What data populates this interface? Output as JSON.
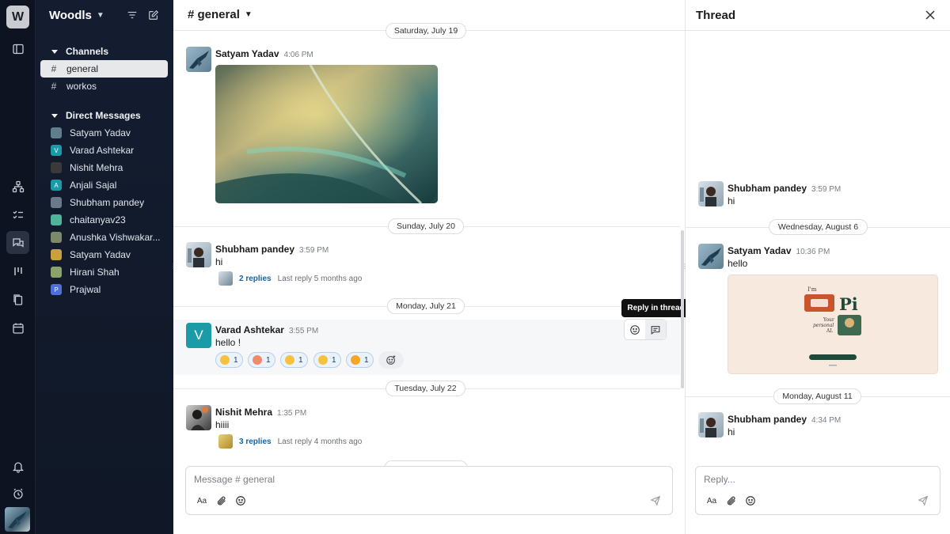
{
  "workspace": {
    "logo_letter": "W",
    "name": "Woodls"
  },
  "sidebar": {
    "channels_label": "Channels",
    "channels": [
      {
        "label": "general",
        "active": true
      },
      {
        "label": "workos",
        "active": false
      }
    ],
    "dm_label": "Direct Messages",
    "dms": [
      {
        "label": "Satyam Yadav",
        "initial": "",
        "color": "#5f7f8f"
      },
      {
        "label": "Varad Ashtekar",
        "initial": "V",
        "color": "#1b9aa8"
      },
      {
        "label": "Nishit Mehra",
        "initial": "",
        "color": "#3a3a3a"
      },
      {
        "label": "Anjali Sajal",
        "initial": "A",
        "color": "#1b9aa8"
      },
      {
        "label": "Shubham pandey",
        "initial": "",
        "color": "#6a7a8a"
      },
      {
        "label": "chaitanyav23",
        "initial": "",
        "color": "#4fb59a"
      },
      {
        "label": "Anushka Vishwakar...",
        "initial": "",
        "color": "#7c8a6a"
      },
      {
        "label": "Satyam Yadav",
        "initial": "",
        "color": "#c9a03a"
      },
      {
        "label": "Hirani Shah",
        "initial": "",
        "color": "#8aa36a"
      },
      {
        "label": "Prajwal",
        "initial": "P",
        "color": "#4e6fd9"
      }
    ]
  },
  "main": {
    "channel_title": "# general",
    "dates": [
      "Saturday, July 19",
      "Sunday, July 20",
      "Monday, July 21",
      "Tuesday, July 22"
    ],
    "messages": [
      {
        "name": "Satyam Yadav",
        "time": "4:06 PM",
        "text": ""
      },
      {
        "name": "Shubham pandey",
        "time": "3:59 PM",
        "text": "hi",
        "replies": "2 replies",
        "last_reply": "Last reply 5 months ago"
      },
      {
        "name": "Varad Ashtekar",
        "time": "3:55 PM",
        "text": "hello !",
        "avatar_initial": "V"
      },
      {
        "name": "Nishit Mehra",
        "time": "1:35 PM",
        "text": "hiiii",
        "replies": "3 replies",
        "last_reply": "Last reply 4 months ago"
      }
    ],
    "reactions": [
      {
        "count": "1",
        "color": "#f6c23e"
      },
      {
        "count": "1",
        "color": "#f08a6a"
      },
      {
        "count": "1",
        "color": "#f6c23e"
      },
      {
        "count": "1",
        "color": "#f6c23e"
      },
      {
        "count": "1",
        "color": "#f5a623"
      }
    ],
    "tooltip": "Reply in thread",
    "composer_placeholder": "Message # general",
    "format_label": "Aa"
  },
  "thread": {
    "title": "Thread",
    "dates": [
      "Wednesday, August 6",
      "Monday, August 11"
    ],
    "messages": [
      {
        "name": "Shubham pandey",
        "time": "3:59 PM",
        "text": "hi"
      },
      {
        "name": "Satyam Yadav",
        "time": "10:36 PM",
        "text": "hello"
      },
      {
        "name": "Shubham pandey",
        "time": "4:34 PM",
        "text": "hi"
      }
    ],
    "card": {
      "line1": "I'm",
      "big": "Pi",
      "line2": "Your",
      "line3": "personal",
      "line4": "AI."
    },
    "reply_placeholder": "Reply...",
    "format_label": "Aa"
  },
  "colors": {
    "link": "#1264a3",
    "rail_bg": "#0d1320",
    "sidebar_bg": "#141d30"
  }
}
